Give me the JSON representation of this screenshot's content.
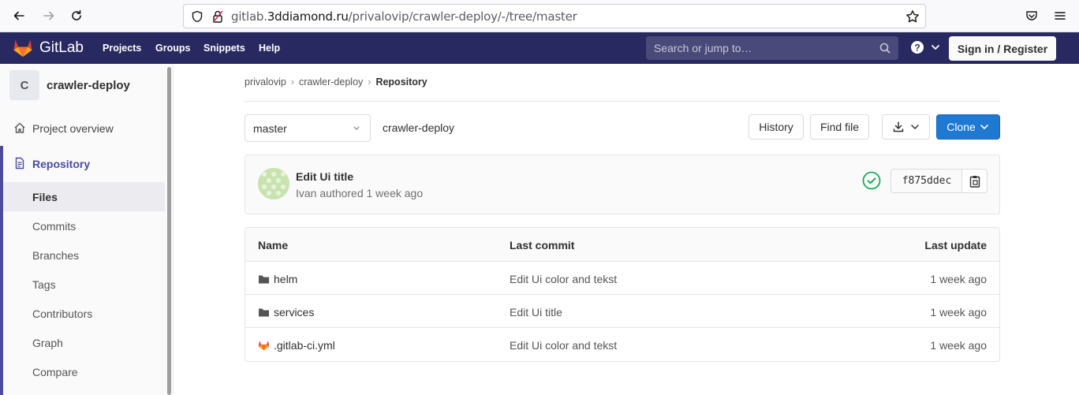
{
  "browser": {
    "url_prefix": "gitlab.",
    "url_domain": "3ddiamond.ru",
    "url_path": "/privalovip/crawler-deploy/-/tree/master"
  },
  "header": {
    "logo_text": "GitLab",
    "nav": [
      "Projects",
      "Groups",
      "Snippets",
      "Help"
    ],
    "search_placeholder": "Search or jump to…",
    "signin_label": "Sign in / Register"
  },
  "sidebar": {
    "project_initial": "C",
    "project_name": "crawler-deploy",
    "project_overview": "Project overview",
    "repository": "Repository",
    "sub_items": [
      "Files",
      "Commits",
      "Branches",
      "Tags",
      "Contributors",
      "Graph",
      "Compare"
    ],
    "active_sub": "Files"
  },
  "breadcrumb": {
    "items": [
      "privalovip",
      "crawler-deploy"
    ],
    "current": "Repository"
  },
  "toolbar": {
    "branch": "master",
    "path": "crawler-deploy",
    "history_label": "History",
    "find_file_label": "Find file",
    "clone_label": "Clone"
  },
  "commit": {
    "title": "Edit Ui title",
    "meta": "Ivan authored 1 week ago",
    "sha": "f875ddec",
    "status": "passed",
    "status_color": "#1aaa55"
  },
  "files": {
    "headers": [
      "Name",
      "Last commit",
      "Last update"
    ],
    "rows": [
      {
        "name": "helm",
        "type": "folder",
        "commit": "Edit Ui color and tekst",
        "updated": "1 week ago"
      },
      {
        "name": "services",
        "type": "folder",
        "commit": "Edit Ui title",
        "updated": "1 week ago"
      },
      {
        "name": ".gitlab-ci.yml",
        "type": "gitlab-ci-file",
        "commit": "Edit Ui color and tekst",
        "updated": "1 week ago"
      }
    ]
  },
  "colors": {
    "header_bg": "#292961",
    "clone_bg": "#1f78d1",
    "sidebar_accent": "#4b4ba3"
  }
}
